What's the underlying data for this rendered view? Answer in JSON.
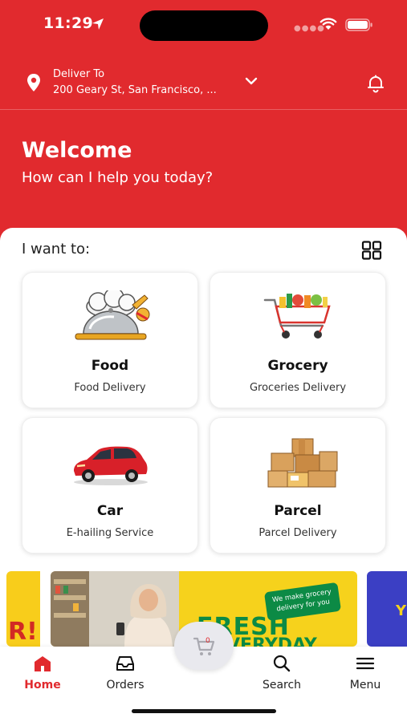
{
  "status_bar": {
    "time": "11:29"
  },
  "header": {
    "deliver_label": "Deliver To",
    "deliver_address": "200 Geary St, San Francisco, ...",
    "welcome_title": "Welcome",
    "welcome_subtitle": "How can I help you today?"
  },
  "section": {
    "label": "I want to:"
  },
  "services": [
    {
      "title": "Food",
      "subtitle": "Food Delivery",
      "icon": "food-cloche-icon"
    },
    {
      "title": "Grocery",
      "subtitle": "Groceries Delivery",
      "icon": "grocery-cart-icon"
    },
    {
      "title": "Car",
      "subtitle": "E-hailing Service",
      "icon": "red-car-icon"
    },
    {
      "title": "Parcel",
      "subtitle": "Parcel Delivery",
      "icon": "parcel-boxes-icon"
    }
  ],
  "banner": {
    "badge": "We make grocery delivery for you",
    "headline": "FRESH",
    "headline2": "EVERYDAY",
    "left_fragment": "R!",
    "right_fragment": "Y"
  },
  "cart": {
    "count": "0"
  },
  "nav": {
    "home": "Home",
    "orders": "Orders",
    "search": "Search",
    "menu": "Menu"
  },
  "colors": {
    "brand_red": "#e12a2e",
    "banner_yellow": "#f6d21c",
    "banner_green": "#0c8a45"
  }
}
